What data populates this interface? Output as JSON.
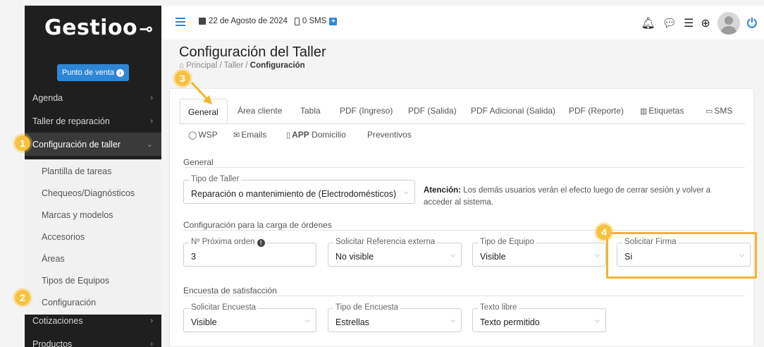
{
  "app": {
    "logo": "Gestioo",
    "pos_button": "Punto de venta"
  },
  "topbar": {
    "date": "22 de Agosto de 2024",
    "sms": "0 SMS",
    "icons": [
      "menu-icon",
      "calendar-icon",
      "phone-icon",
      "plus-icon",
      "bell-icon",
      "chat-icon",
      "tasks-icon",
      "support-icon",
      "avatar",
      "power-icon"
    ]
  },
  "sidebar": {
    "items": [
      {
        "label": "Agenda"
      },
      {
        "label": "Taller de reparación"
      },
      {
        "label": "Configuración de taller"
      },
      {
        "label": "Cotizaciones"
      },
      {
        "label": "Productos"
      }
    ],
    "submenu": [
      {
        "label": "Plantilla de tareas"
      },
      {
        "label": "Chequeos/Diagnósticos"
      },
      {
        "label": "Marcas y modelos"
      },
      {
        "label": "Accesorios"
      },
      {
        "label": "Áreas"
      },
      {
        "label": "Tipos de Equipos"
      },
      {
        "label": "Configuración"
      }
    ]
  },
  "page": {
    "title": "Configuración del Taller",
    "breadcrumb": {
      "home": "Principal",
      "sep1": "/",
      "mid": "Taller",
      "sep2": "/",
      "current": "Configuración"
    }
  },
  "tabs": {
    "row1": [
      {
        "label": "General"
      },
      {
        "label": "Área cliente"
      },
      {
        "label": "Tabla"
      },
      {
        "label": "PDF (Ingreso)"
      },
      {
        "label": "PDF (Salida)"
      },
      {
        "label": "PDF Adicional (Salida)"
      },
      {
        "label": "PDF (Reporte)"
      },
      {
        "label": "Etiquetas"
      },
      {
        "label": "SMS"
      }
    ],
    "row2": [
      {
        "label": "WSP"
      },
      {
        "label": "Emails"
      },
      {
        "label": "APP",
        "suffix": "Domicilio"
      },
      {
        "label": "Preventivos"
      }
    ]
  },
  "form": {
    "general_label": "General",
    "tipo_taller": {
      "label": "Tipo de Taller",
      "value": "Reparación o mantenimiento de (Electrodomésticos)"
    },
    "notice": {
      "bold": "Atención:",
      "text": " Los demás usuarios verán el efecto luego de cerrar sesión y volver a acceder al sistema."
    },
    "carga_label": "Configuración para la carga de órdenes",
    "proxima_orden": {
      "label": "Nº Próxima orden",
      "value": "3"
    },
    "referencia_externa": {
      "label": "Solicitar Referencia externa",
      "value": "No visible"
    },
    "tipo_equipo": {
      "label": "Tipo de Equipo",
      "value": "Visible"
    },
    "solicitar_firma": {
      "label": "Solicitar Firma",
      "value": "Si"
    },
    "encuesta_label": "Encuesta de satisfacción",
    "solicitar_encuesta": {
      "label": "Solicitar Encuesta",
      "value": "Visible"
    },
    "tipo_encuesta": {
      "label": "Tipo de Encuesta",
      "value": "Estrellas"
    },
    "texto_libre": {
      "label": "Texto libre",
      "value": "Texto permitido"
    }
  },
  "markers": [
    "1",
    "2",
    "3",
    "4"
  ],
  "colors": {
    "accent": "#2f86d6",
    "sidebar": "#1f1f1f",
    "marker": "#f7c23c"
  }
}
